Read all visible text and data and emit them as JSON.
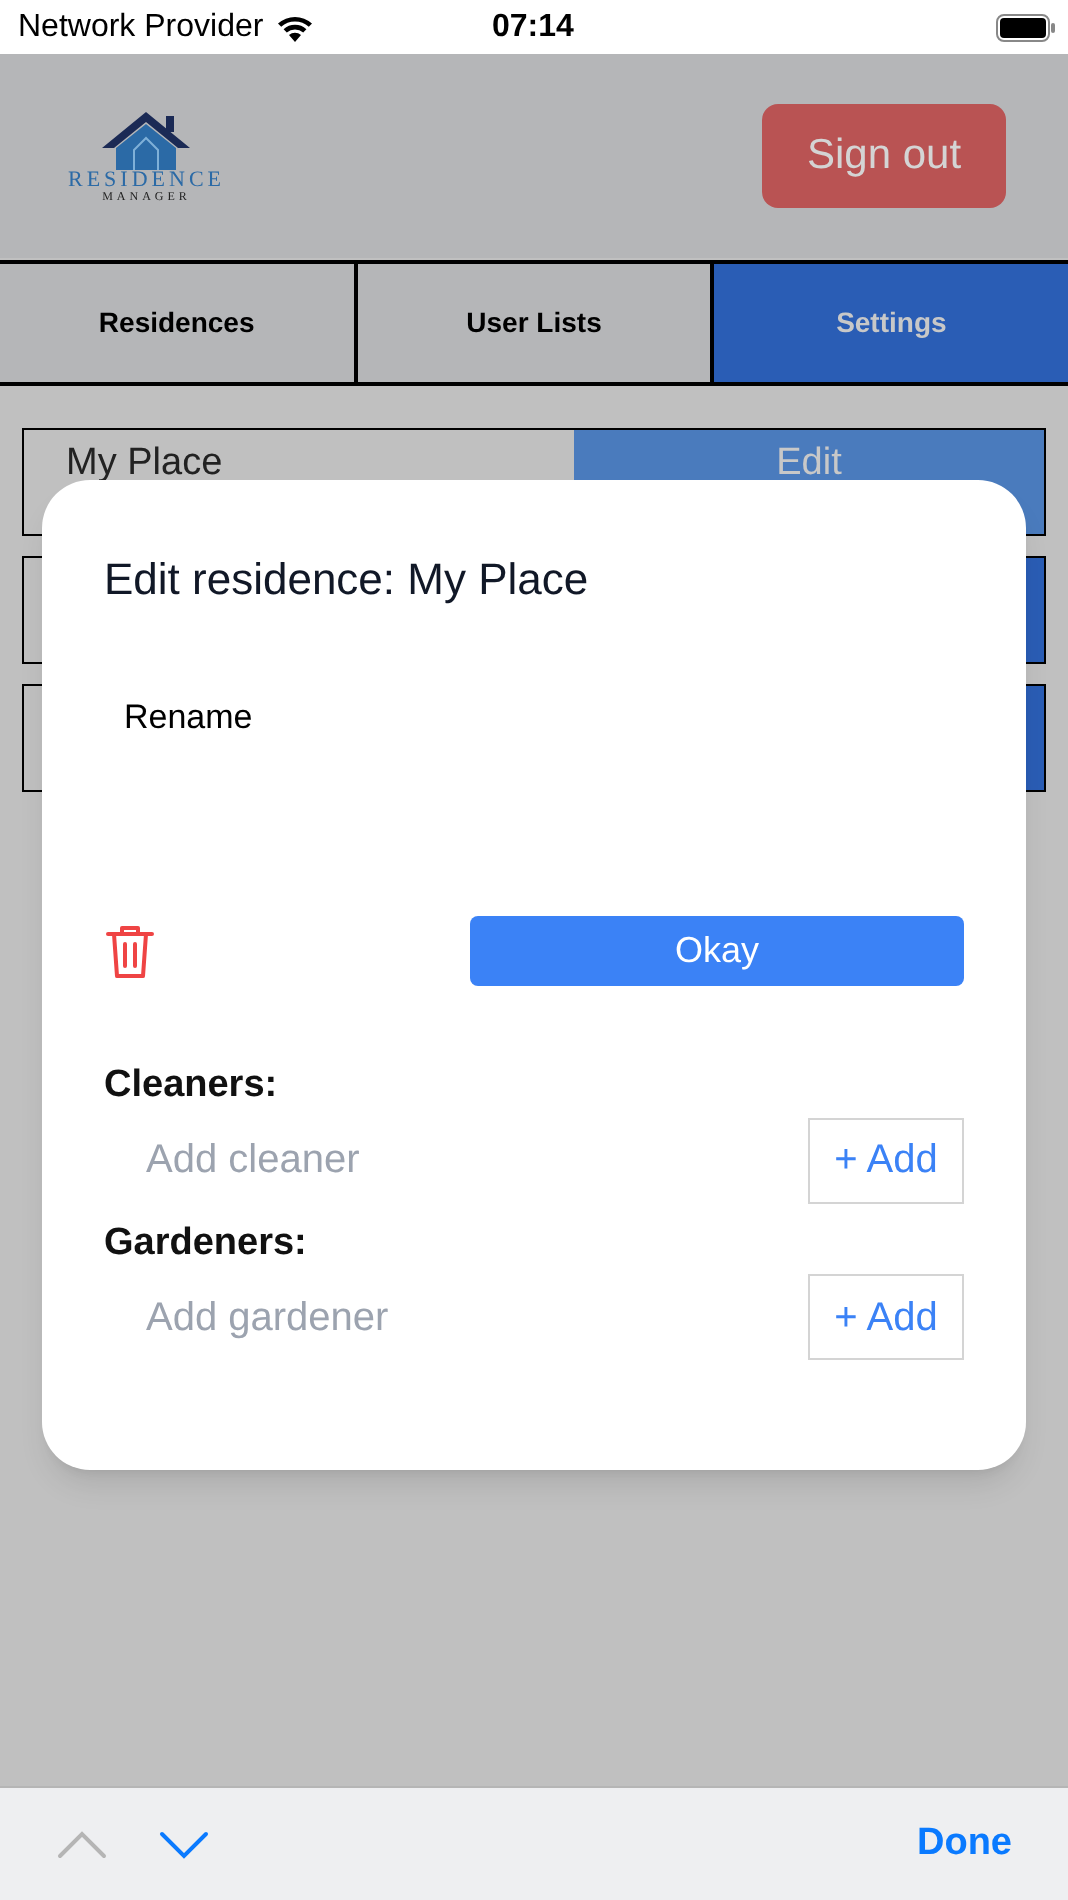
{
  "status_bar": {
    "carrier": "Network Provider",
    "time": "07:14"
  },
  "header": {
    "logo": {
      "name": "RESIDENCE",
      "subtitle": "MANAGER"
    },
    "sign_out": "Sign out"
  },
  "tabs": [
    {
      "label": "Residences",
      "selected": false
    },
    {
      "label": "User Lists",
      "selected": false
    },
    {
      "label": "Settings",
      "selected": true
    }
  ],
  "residences": [
    {
      "name": "My Place",
      "action": "Edit"
    }
  ],
  "dialog": {
    "title": "Edit residence: My Place",
    "rename": {
      "value": "Rename"
    },
    "okay": "Okay",
    "sections": [
      {
        "title": "Cleaners:",
        "placeholder": "Add cleaner",
        "add": "+ Add"
      },
      {
        "title": "Gardeners:",
        "placeholder": "Add gardener",
        "add": "+ Add"
      }
    ]
  },
  "keyboard_toolbar": {
    "previous_disabled": true,
    "next_disabled": false,
    "done": "Done"
  }
}
